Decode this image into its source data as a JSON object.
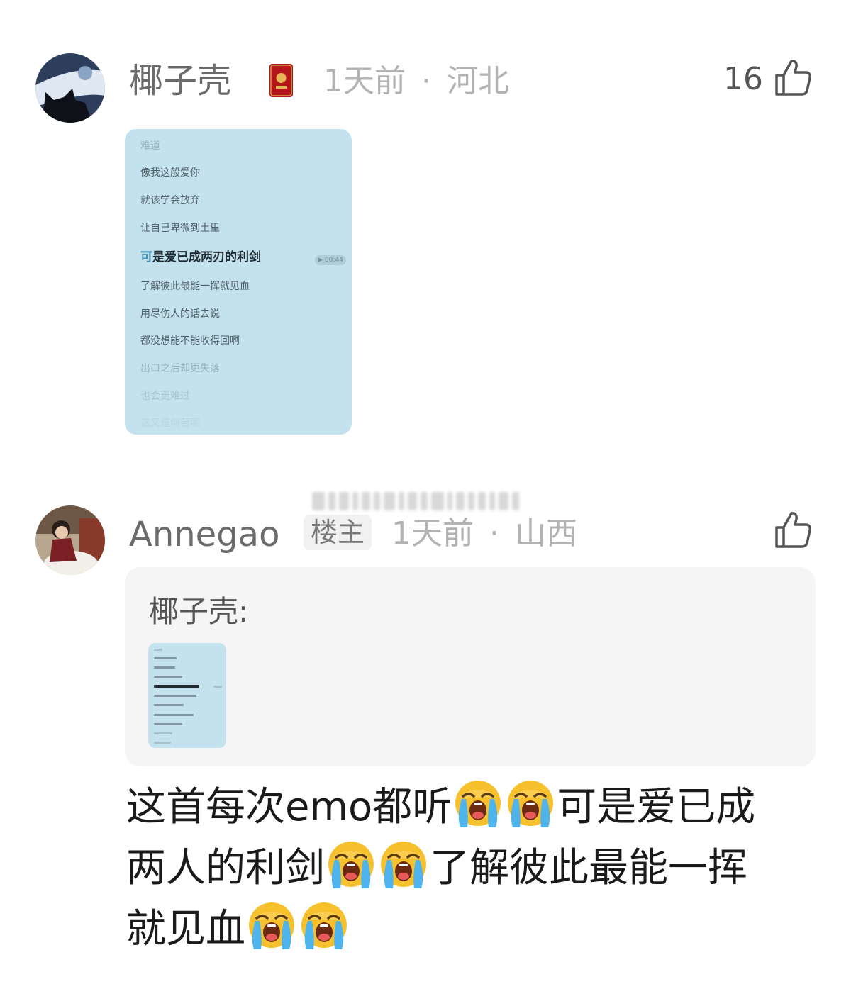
{
  "comment1": {
    "username": "椰子壳",
    "time": "1天前",
    "separator": "·",
    "location": "河北",
    "like_count": "16",
    "badge_icon": "red-envelope-icon",
    "attachment": {
      "lyrics": [
        "难道",
        "像我这般爱你",
        "就该学会放弃",
        "让自己卑微到土里",
        "了解彼此最能一挥就见血",
        "用尽伤人的话去说",
        "都没想能不能收得回啊",
        "出口之后却更失落",
        "也会更难过",
        "这又是何苦呢"
      ],
      "current_line_highlight": "可",
      "current_line_rest": "是爱已成两刃的利剑",
      "time_label": "▶ 00:44"
    }
  },
  "comment2": {
    "username": "Annegao",
    "badge": "楼主",
    "time": "1天前",
    "separator": "·",
    "location": "山西",
    "quote": {
      "author": "椰子壳:"
    },
    "reply_lines": [
      "这首每次emo都听",
      "可是爱已成",
      "两人的利剑",
      "了解彼此最能一挥",
      "就见血"
    ],
    "emoji_name": "loudly-crying-face"
  },
  "colors": {
    "card": "#c3e2ee",
    "quote_bg": "#f5f5f5",
    "meta": "#b3b3b3",
    "name": "#6b6b6b"
  }
}
